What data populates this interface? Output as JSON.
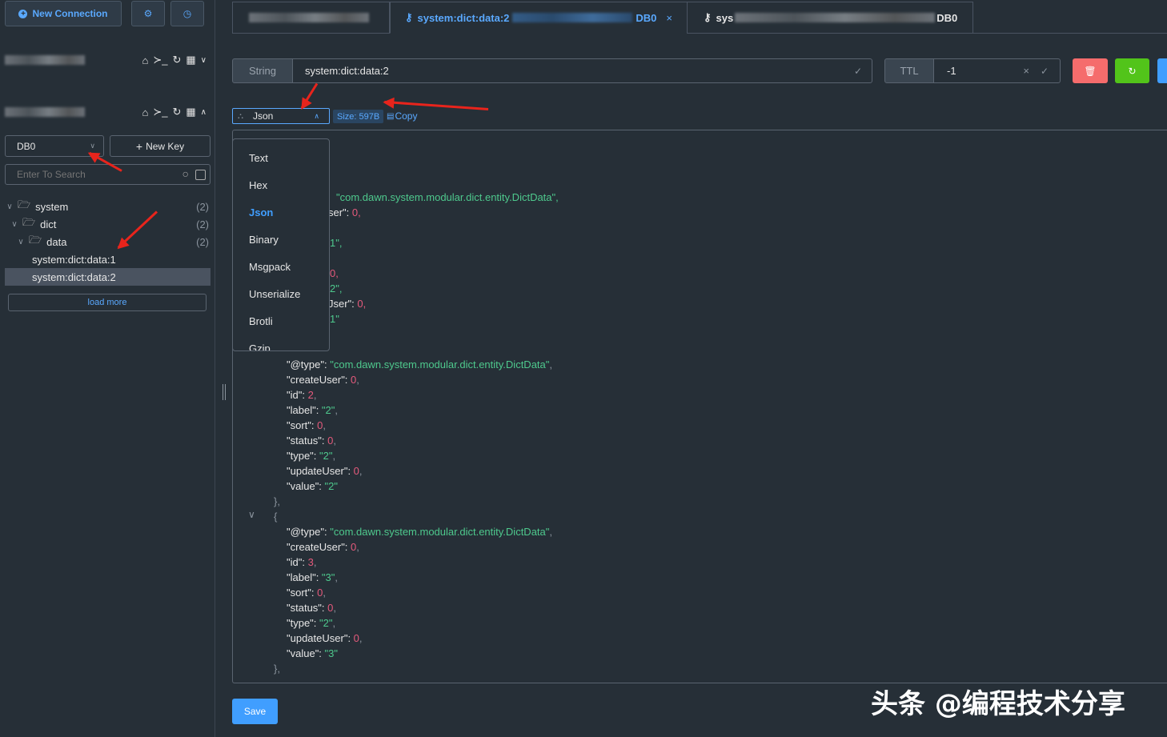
{
  "sidebar": {
    "new_connection": "New Connection",
    "db_select": "DB0",
    "new_key": "New Key",
    "search_placeholder": "Enter To Search",
    "tree": [
      {
        "label": "system",
        "count": "(2)"
      },
      {
        "label": "dict",
        "count": "(2)"
      },
      {
        "label": "data",
        "count": "(2)"
      }
    ],
    "keys": [
      "system:dict:data:1",
      "system:dict:data:2"
    ],
    "load_more": "load more"
  },
  "tabs": [
    {
      "label": "",
      "suffix": ""
    },
    {
      "label": "system:dict:data:2",
      "suffix": "DB0"
    },
    {
      "label": "sys",
      "suffix": "DB0"
    }
  ],
  "key_bar": {
    "type": "String",
    "key_name": "system:dict:data:2",
    "ttl_label": "TTL",
    "ttl_value": "-1"
  },
  "format_bar": {
    "format": "Json",
    "size": "Size: 597B",
    "copy": "Copy"
  },
  "format_options": [
    "Text",
    "Hex",
    "Json",
    "Binary",
    "Msgpack",
    "Unserialize",
    "Brotli",
    "Gzip"
  ],
  "json_visible": {
    "partial_1": "\"com.dawn.system.modular.dict.entity.DictData\",",
    "partial_2": "ser\": ",
    "partial_3": "1\",",
    "partial_4": "0,",
    "partial_5": "2\",",
    "partial_6": "Jser\": ",
    "partial_7": "1\""
  },
  "json_blocks": [
    {
      "type_val": "\"com.dawn.system.modular.dict.entity.DictData\"",
      "createUser": "0",
      "id": "2",
      "label": "\"2\"",
      "sort": "0",
      "status": "0",
      "type": "\"2\"",
      "updateUser": "0",
      "value": "\"2\""
    },
    {
      "type_val": "\"com.dawn.system.modular.dict.entity.DictData\"",
      "createUser": "0",
      "id": "3",
      "label": "\"3\"",
      "sort": "0",
      "status": "0",
      "type": "\"2\"",
      "updateUser": "0",
      "value": "\"3\""
    }
  ],
  "save": "Save",
  "watermark": "头条 @编程技术分享"
}
